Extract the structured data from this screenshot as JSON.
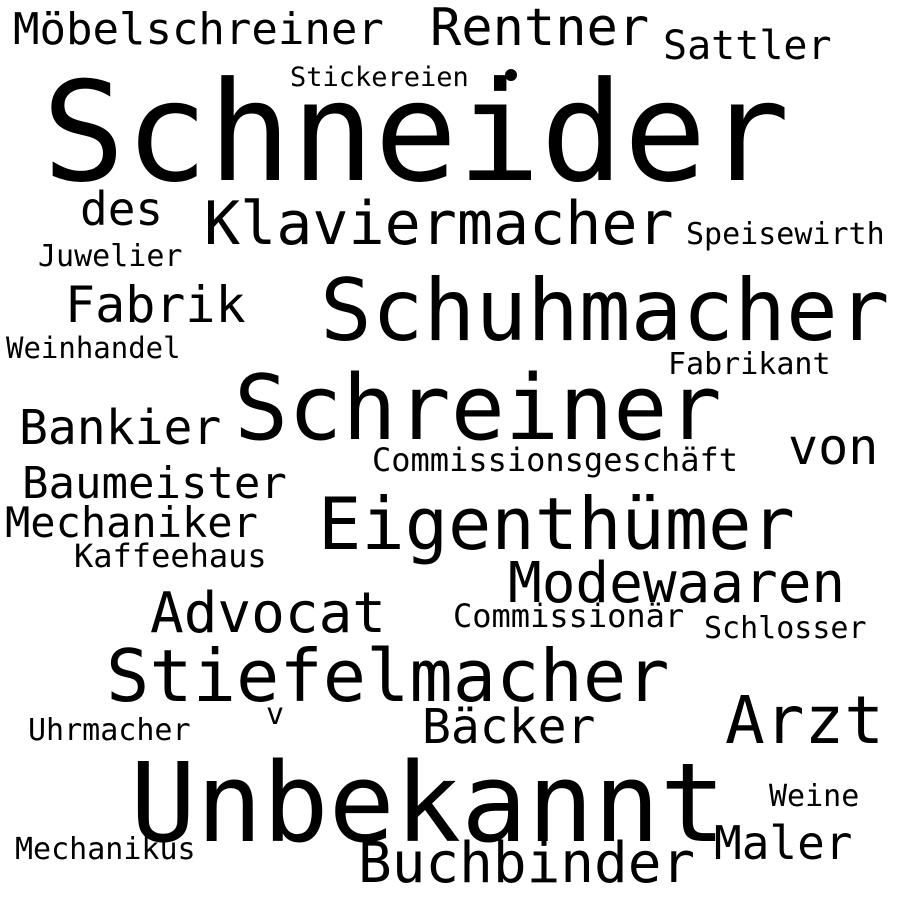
{
  "word_cloud": {
    "text_color": "#000000",
    "background_color": "#ffffff",
    "words": [
      "Möbelschreiner",
      "Rentner",
      "Sattler",
      "Stickereien",
      "Schneider",
      "des",
      "Klaviermacher",
      "Speisewirth",
      "Juwelier",
      "Fabrik",
      "Schuhmacher",
      "Weinhandel",
      "Fabrikant",
      "Schreiner",
      "Bankier",
      "von",
      "Commissionsgeschäft",
      "Baumeister",
      "Eigenthümer",
      "Mechaniker",
      "Kaffeehaus",
      "Modewaaren",
      "Advocat",
      "Commissionär",
      "Schlosser",
      "Stiefelmacher",
      "Arzt",
      "Uhrmacher",
      "v",
      "Bäcker",
      "Unbekannt",
      "Weine",
      "Mechanikus",
      "Maler",
      "Buchbinder"
    ]
  }
}
